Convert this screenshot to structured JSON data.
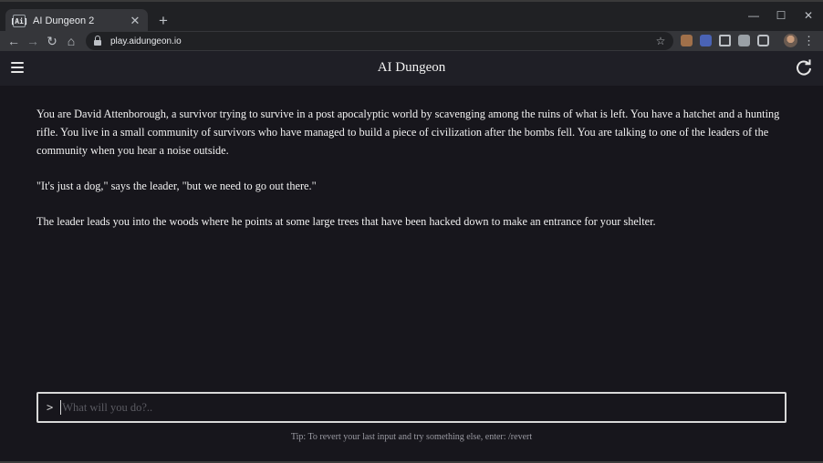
{
  "browser": {
    "tab": {
      "favicon_text": "[Ai]",
      "title": "AI Dungeon 2",
      "close": "✕"
    },
    "new_tab": "+",
    "window": {
      "minimize": "—",
      "maximize": "☐",
      "close": "✕"
    },
    "nav": {
      "back": "←",
      "forward": "→",
      "reload": "↻",
      "home": "⌂"
    },
    "url": "play.aidungeon.io",
    "bookmark_icon": "star-icon",
    "menu": "⋮"
  },
  "app": {
    "title": "AI Dungeon",
    "menu_icon": "hamburger-menu-icon",
    "refresh_icon": "refresh-icon",
    "story": [
      "You are David Attenborough, a survivor trying to survive in a post apocalyptic world by scavenging among the ruins of what is left. You have a hatchet and a hunting rifle. You live in a small community of survivors who have managed to build a piece of civilization after the bombs fell. You are talking to one of the leaders of the community when you hear a noise outside.",
      "\"It's just a dog,\" says the leader, \"but we need to go out there.\"",
      "The leader leads you into the woods where he points at some large trees that have been hacked down to make an entrance for your shelter."
    ],
    "input": {
      "prompt_symbol": ">",
      "placeholder": "What will you do?..",
      "value": ""
    },
    "tip": "Tip: To revert your last input and try something else, enter: /revert"
  },
  "colors": {
    "chrome_bg": "#202124",
    "toolbar_bg": "#35363a",
    "header_bg": "#1f1f26",
    "main_bg": "#17161c",
    "text": "#f2f2f2"
  }
}
